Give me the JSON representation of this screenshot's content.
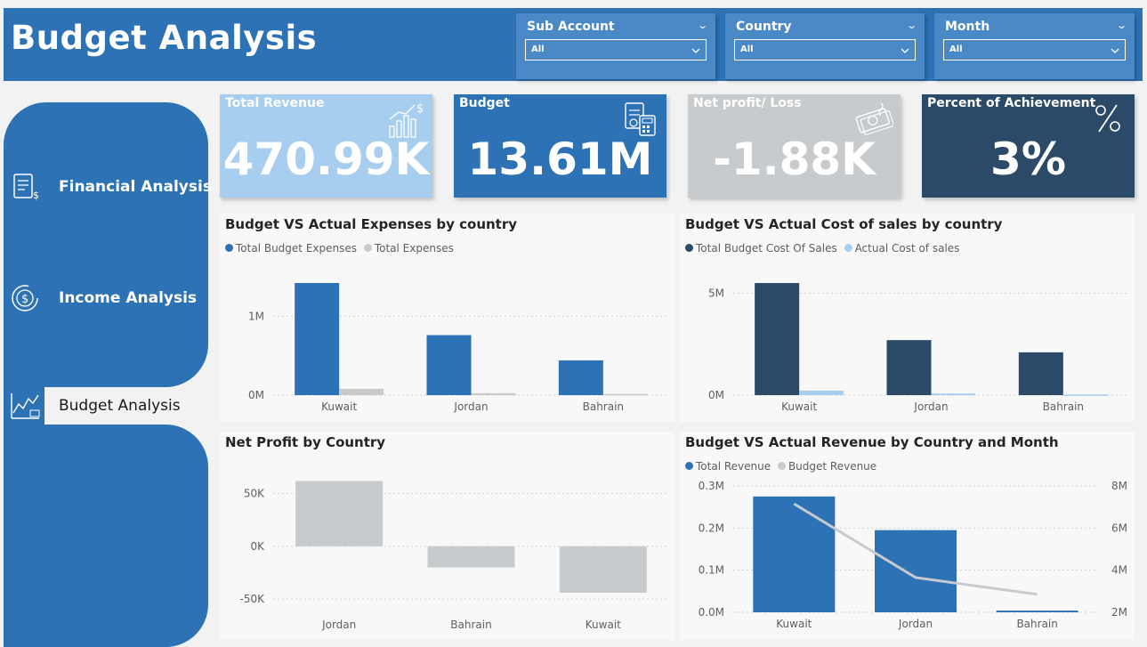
{
  "header": {
    "title": "Budget Analysis"
  },
  "slicers": [
    {
      "label": "Sub Account",
      "value": "All"
    },
    {
      "label": "Country",
      "value": "All"
    },
    {
      "label": "Month",
      "value": "All"
    }
  ],
  "nav": {
    "items": [
      {
        "label": "Financial Analysis",
        "icon": "document-dollar-icon"
      },
      {
        "label": "Income Analysis",
        "icon": "dollar-refresh-icon"
      },
      {
        "label": "Budget Analysis",
        "icon": "trend-chart-icon"
      }
    ]
  },
  "kpis": [
    {
      "label": "Total Revenue",
      "value": "470.99K",
      "color": "#a7cdef",
      "icon": "growth-bars-icon"
    },
    {
      "label": "Budget",
      "value": "13.61M",
      "color": "#2d72b4",
      "icon": "calculator-icon"
    },
    {
      "label": "Net profit/ Loss",
      "value": "-1.88K",
      "color": "#c8cbcd",
      "icon": "cash-icon"
    },
    {
      "label": "Percent of Achievement",
      "value": "3%",
      "color": "#2b4a68",
      "icon": "percent-icon"
    }
  ],
  "chart_data": [
    {
      "type": "bar",
      "title": "Budget VS Actual Expenses by country",
      "categories": [
        "Kuwait",
        "Jordan",
        "Bahrain"
      ],
      "series": [
        {
          "name": "Total Budget Expenses",
          "color": "#2d72b4",
          "values": [
            1420000,
            760000,
            440000
          ]
        },
        {
          "name": "Total Expenses",
          "color": "#c8cbcd",
          "values": [
            80000,
            25000,
            15000
          ]
        }
      ],
      "yticks": [
        {
          "v": 0,
          "label": "0M"
        },
        {
          "v": 1000000,
          "label": "1M"
        }
      ],
      "ylim": [
        0,
        1600000
      ],
      "legend": "top-left"
    },
    {
      "type": "bar",
      "title": "Budget VS Actual Cost of sales by country",
      "categories": [
        "Kuwait",
        "Jordan",
        "Bahrain"
      ],
      "series": [
        {
          "name": "Total Budget Cost Of Sales",
          "color": "#2b4a68",
          "values": [
            5500000,
            2700000,
            2100000
          ]
        },
        {
          "name": "Actual Cost of sales",
          "color": "#a7cdef",
          "values": [
            220000,
            80000,
            30000
          ]
        }
      ],
      "yticks": [
        {
          "v": 0,
          "label": "0M"
        },
        {
          "v": 5000000,
          "label": "5M"
        }
      ],
      "ylim": [
        0,
        6200000
      ],
      "legend": "top-left"
    },
    {
      "type": "bar",
      "title": "Net Profit by Country",
      "categories": [
        "Jordan",
        "Bahrain",
        "Kuwait"
      ],
      "series": [
        {
          "name": "",
          "color": "#c8cbcd",
          "values": [
            62000,
            -20000,
            -44000
          ]
        }
      ],
      "yticks": [
        {
          "v": 50000,
          "label": "50K"
        },
        {
          "v": 0,
          "label": "0K"
        },
        {
          "v": -50000,
          "label": "-50K"
        }
      ],
      "ylim": [
        -60000,
        75000
      ],
      "legend": "none"
    },
    {
      "type": "bar",
      "title": "Budget VS Actual Revenue by Country and Month",
      "categories": [
        "Kuwait",
        "Jordan",
        "Bahrain"
      ],
      "series": [
        {
          "name": "Total Revenue",
          "color": "#2d72b4",
          "values": [
            275000,
            195000,
            4000
          ],
          "axis": "left"
        },
        {
          "name": "Budget Revenue",
          "color": "#c8cbcd",
          "values": [
            7150000,
            3650000,
            2850000
          ],
          "axis": "right",
          "render": "line"
        }
      ],
      "yticks": [
        {
          "v": 0,
          "label": "0.0M"
        },
        {
          "v": 100000,
          "label": "0.1M"
        },
        {
          "v": 200000,
          "label": "0.2M"
        },
        {
          "v": 300000,
          "label": "0.3M"
        }
      ],
      "ylim": [
        0,
        300000
      ],
      "y2ticks": [
        {
          "v": 2000000,
          "label": "2M"
        },
        {
          "v": 4000000,
          "label": "4M"
        },
        {
          "v": 6000000,
          "label": "6M"
        },
        {
          "v": 8000000,
          "label": "8M"
        }
      ],
      "y2lim": [
        2000000,
        8000000
      ],
      "legend": "top-left"
    }
  ]
}
